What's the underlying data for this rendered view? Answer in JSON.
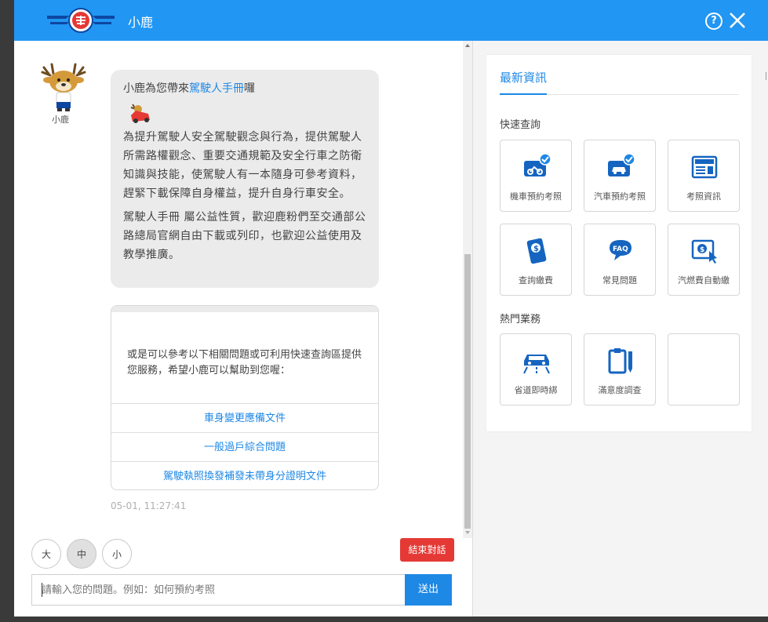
{
  "header": {
    "title": "小鹿",
    "help_icon": "question-circle-icon",
    "close_icon": "close-x-icon",
    "bg_color": "#2196f3"
  },
  "bot": {
    "name": "小鹿",
    "avatar_icon": "deer-mascot-icon"
  },
  "message": {
    "intro_prefix": "小鹿為您帶來",
    "intro_link": "駕駛人手冊",
    "intro_suffix": "囉",
    "paragraph1": "為提升駕駛人安全駕駛觀念與行為，提供駕駛人所需路權觀念、重要交通規範及安全行車之防衛知識與技能，使駕駛人有一本隨身可參考資料，趕緊下載保障自身權益，提升自身行車安全。",
    "paragraph2": "駕駛人手冊 屬公益性質，歡迎鹿粉們至交通部公路總局官網自由下載或列印，也歡迎公益使用及教學推廣。"
  },
  "suggestions": {
    "text": "或是可以參考以下相關問題或可利用快速查詢區提供您服務，希望小鹿可以幫助到您喔：",
    "links": [
      "車身變更應備文件",
      "一般過戶綜合問題",
      "駕駛執照換發補發未帶身分證明文件"
    ]
  },
  "timestamp": "05-01, 11:27:41",
  "font_sizes": [
    "大",
    "中",
    "小"
  ],
  "font_size_selected": "中",
  "end_button": "結束對話",
  "input": {
    "placeholder": "請輸入您的問題。例如：如何預約考照",
    "value": ""
  },
  "send_button": "送出",
  "panel": {
    "tab": "最新資訊",
    "quick_title": "快速查詢",
    "quick_items": [
      {
        "label": "機車預約考照",
        "icon": "motorcycle-booking-icon"
      },
      {
        "label": "汽車預約考照",
        "icon": "car-booking-icon"
      },
      {
        "label": "考照資訊",
        "icon": "news-icon"
      },
      {
        "label": "查詢繳費",
        "icon": "payment-phone-icon"
      },
      {
        "label": "常見問題",
        "icon": "faq-icon"
      },
      {
        "label": "汽燃費自動繳",
        "icon": "auto-pay-icon"
      }
    ],
    "hot_title": "熱門業務",
    "hot_items": [
      {
        "label": "省道即時綁",
        "icon": "highway-traffic-icon"
      },
      {
        "label": "滿意度調查",
        "icon": "survey-clipboard-icon"
      },
      {
        "label": "",
        "icon": ""
      }
    ]
  },
  "colors": {
    "accent": "#1e88e5",
    "danger": "#e53935",
    "bubble": "#ebebeb"
  }
}
